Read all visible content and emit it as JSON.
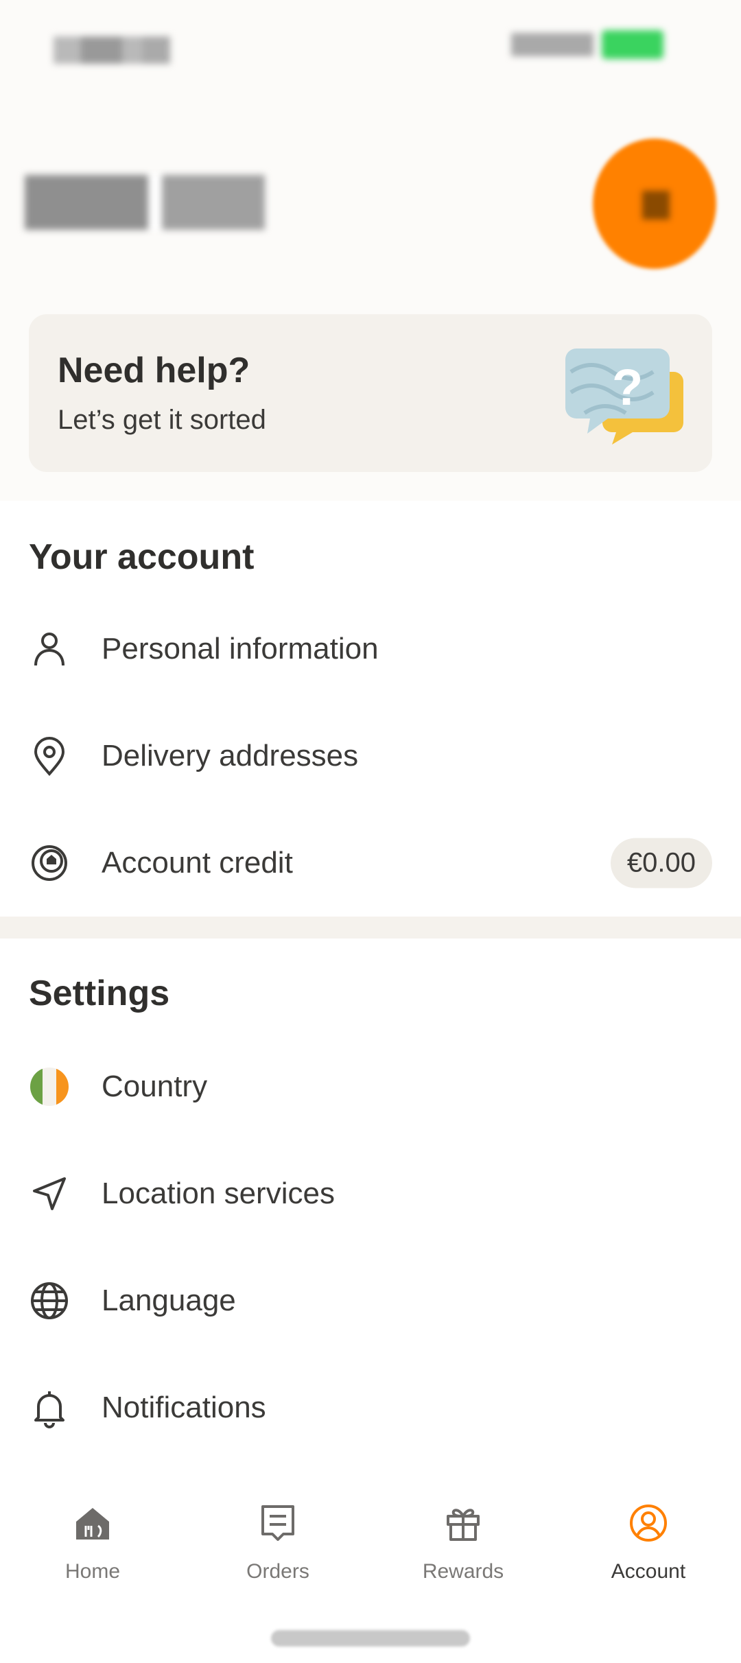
{
  "help": {
    "title": "Need help?",
    "subtitle": "Let’s get it sorted"
  },
  "account": {
    "title": "Your account",
    "items": [
      {
        "label": "Personal information",
        "icon": "person-icon"
      },
      {
        "label": "Delivery addresses",
        "icon": "location-pin-icon"
      },
      {
        "label": "Account credit",
        "icon": "credit-icon",
        "badge": "€0.00"
      }
    ]
  },
  "settings": {
    "title": "Settings",
    "items": [
      {
        "label": "Country",
        "icon": "ireland-flag-icon"
      },
      {
        "label": "Location services",
        "icon": "navigation-arrow-icon"
      },
      {
        "label": "Language",
        "icon": "globe-icon"
      },
      {
        "label": "Notifications",
        "icon": "bell-icon"
      }
    ]
  },
  "nav": {
    "items": [
      {
        "label": "Home",
        "icon": "home-icon"
      },
      {
        "label": "Orders",
        "icon": "receipt-icon"
      },
      {
        "label": "Rewards",
        "icon": "gift-icon"
      },
      {
        "label": "Account",
        "icon": "account-icon",
        "active": true
      }
    ]
  },
  "colors": {
    "accent": "#ff8000",
    "text": "#3b3a38",
    "card": "#f4f1ec",
    "flag_green": "#6ca144",
    "flag_orange": "#f7941d"
  }
}
